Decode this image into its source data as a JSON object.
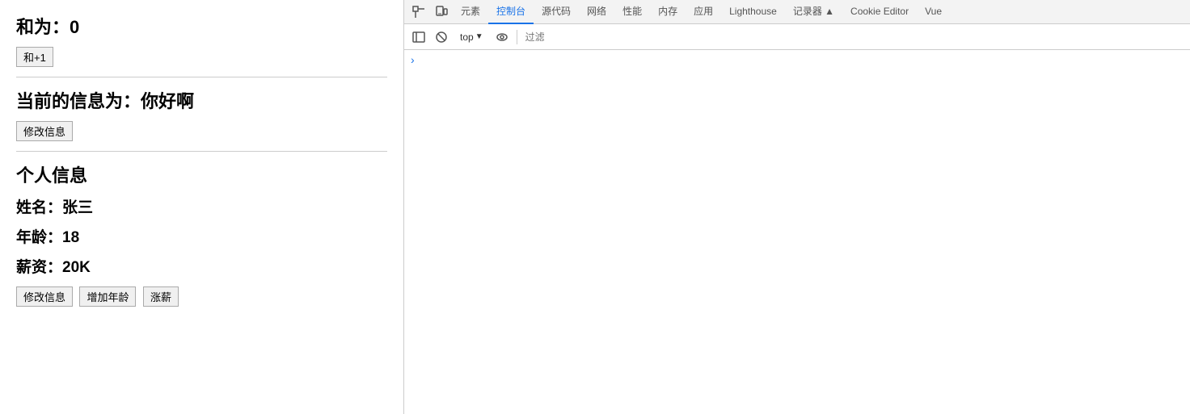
{
  "leftPanel": {
    "sumSection": {
      "title": "和为：0",
      "button": "和+1"
    },
    "messageSection": {
      "title": "当前的信息为：你好啊",
      "button": "修改信息"
    },
    "personalSection": {
      "heading": "个人信息",
      "name": "姓名：张三",
      "age": "年龄：18",
      "salary": "薪资：20K",
      "buttons": [
        "修改信息",
        "增加年龄",
        "涨薪"
      ]
    }
  },
  "devtools": {
    "tabs": [
      {
        "label": "元素",
        "active": false
      },
      {
        "label": "控制台",
        "active": true
      },
      {
        "label": "源代码",
        "active": false
      },
      {
        "label": "网络",
        "active": false
      },
      {
        "label": "性能",
        "active": false
      },
      {
        "label": "内存",
        "active": false
      },
      {
        "label": "应用",
        "active": false
      },
      {
        "label": "Lighthouse",
        "active": false
      },
      {
        "label": "记录器 ▲",
        "active": false
      },
      {
        "label": "Cookie Editor",
        "active": false
      },
      {
        "label": "Vue",
        "active": false
      }
    ],
    "toolbar": {
      "topSelector": "top",
      "filterPlaceholder": "过滤"
    },
    "consoleArrow": "›"
  },
  "icons": {
    "cursor": "⬚",
    "block": "🚫",
    "eye": "👁",
    "play": "▶"
  }
}
